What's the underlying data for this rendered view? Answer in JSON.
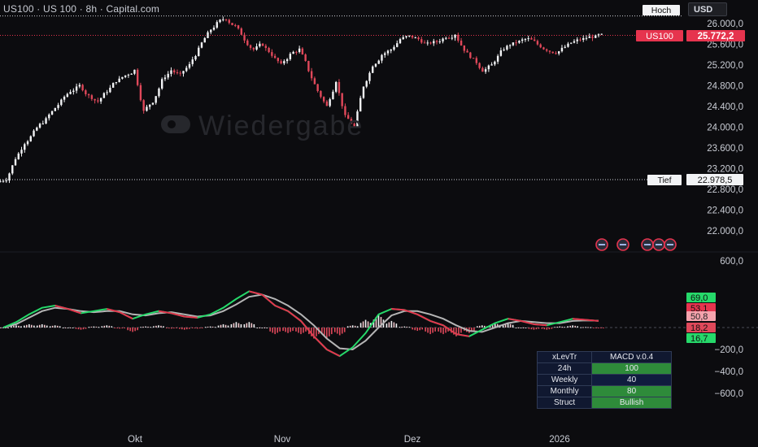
{
  "header": {
    "symbol_title": "US100 · US 100 · 8h · Capital.com",
    "currency_label": "USD"
  },
  "watermark": {
    "text": "Wiedergabe"
  },
  "colors": {
    "background": "#0c0c0f",
    "up_candle": "#f2f3f5",
    "down_candle": "#e0485a",
    "macd_line": "#26d96a",
    "signal_line": "#b5b5b5",
    "accent_red": "#e6344e",
    "table_green": "#2e8b3a",
    "table_blue": "#101c3e"
  },
  "markers": {
    "high_label": "Hoch",
    "low_label": "Tief",
    "low_value": "22.978,5",
    "symbol_tag": "US100",
    "last_price": "25.772,2"
  },
  "price_axis": {
    "ticks": [
      "26.000,0",
      "25.600,0",
      "25.200,0",
      "24.800,0",
      "24.400,0",
      "24.000,0",
      "23.600,0",
      "23.200,0",
      "22.800,0",
      "22.400,0",
      "22.000,0"
    ]
  },
  "macd_axis": {
    "ticks": [
      "600,0",
      "−200,0",
      "−400,0",
      "−600,0"
    ],
    "value_badges": [
      {
        "label": "69,0",
        "color": "#26d96a"
      },
      {
        "label": "53,1",
        "color": "#e6344e"
      },
      {
        "label": "50,8",
        "color": "#f5a3ad"
      },
      {
        "label": "18,2",
        "color": "#e0485a"
      },
      {
        "label": "16,7",
        "color": "#26d96a"
      }
    ]
  },
  "time_axis": {
    "labels": [
      "Okt",
      "Nov",
      "Dez",
      "2026"
    ]
  },
  "indicator_table": {
    "rows": [
      {
        "key": "xLevTr",
        "value": "MACD v.0.4"
      },
      {
        "key": "24h",
        "value": "100"
      },
      {
        "key": "Weekly",
        "value": "40"
      },
      {
        "key": "Monthly",
        "value": "80"
      },
      {
        "key": "Struct",
        "value": "Bullish"
      }
    ]
  },
  "chart_data": [
    {
      "type": "line",
      "title": "US100 · US 100 · 8h · Capital.com",
      "x_labels": [
        "Okt",
        "Nov",
        "Dez",
        "2026"
      ],
      "ylim": [
        21800,
        26200
      ],
      "series": [
        {
          "name": "US100",
          "representation": "candlestick close (approx.)",
          "values": [
            23000,
            23400,
            23700,
            23900,
            24100,
            24300,
            24500,
            24700,
            24800,
            24600,
            24500,
            24700,
            24900,
            25000,
            25100,
            24300,
            24500,
            24900,
            25100,
            25000,
            25200,
            25500,
            25800,
            26000,
            26100,
            25950,
            25700,
            25500,
            25600,
            25400,
            25200,
            25400,
            25500,
            25100,
            24700,
            24400,
            24900,
            24200,
            24000,
            24800,
            25200,
            25400,
            25500,
            25700,
            25750,
            25700,
            25600,
            25650,
            25750,
            25800,
            25500,
            25300,
            25100,
            25200,
            25450,
            25600,
            25650,
            25700,
            25600,
            25500,
            25450,
            25550,
            25650,
            25700,
            25750,
            25772.2
          ]
        }
      ],
      "high": 26100,
      "low": 22978.5,
      "last": 25772.2
    },
    {
      "type": "line",
      "title": "MACD",
      "ylim": [
        -700,
        700
      ],
      "series": [
        {
          "name": "MACD",
          "values": [
            0,
            50,
            120,
            180,
            200,
            170,
            130,
            150,
            170,
            140,
            80,
            120,
            150,
            130,
            100,
            90,
            120,
            180,
            260,
            330,
            300,
            200,
            150,
            60,
            -80,
            -200,
            -260,
            -180,
            -50,
            120,
            170,
            160,
            120,
            60,
            20,
            -60,
            -80,
            -20,
            40,
            80,
            60,
            30,
            20,
            50,
            80,
            70,
            60
          ]
        },
        {
          "name": "Signal",
          "values": [
            0,
            30,
            90,
            150,
            180,
            170,
            150,
            140,
            150,
            150,
            120,
            110,
            130,
            140,
            120,
            100,
            110,
            150,
            210,
            280,
            300,
            260,
            200,
            120,
            20,
            -100,
            -190,
            -200,
            -120,
            0,
            110,
            150,
            150,
            120,
            80,
            20,
            -30,
            -40,
            0,
            40,
            60,
            50,
            40,
            40,
            60,
            65,
            62
          ]
        },
        {
          "name": "Histogram",
          "values": [
            0,
            20,
            30,
            30,
            20,
            0,
            -20,
            10,
            20,
            -10,
            -40,
            10,
            20,
            -10,
            -20,
            -10,
            10,
            30,
            50,
            50,
            0,
            -60,
            -50,
            -60,
            -100,
            -100,
            -70,
            20,
            70,
            120,
            60,
            10,
            -30,
            -60,
            -60,
            -80,
            -50,
            20,
            40,
            40,
            0,
            -20,
            -20,
            10,
            20,
            5,
            -2
          ]
        }
      ],
      "tick_labels": [
        "600,0",
        "−200,0",
        "−400,0",
        "−600,0"
      ]
    }
  ]
}
